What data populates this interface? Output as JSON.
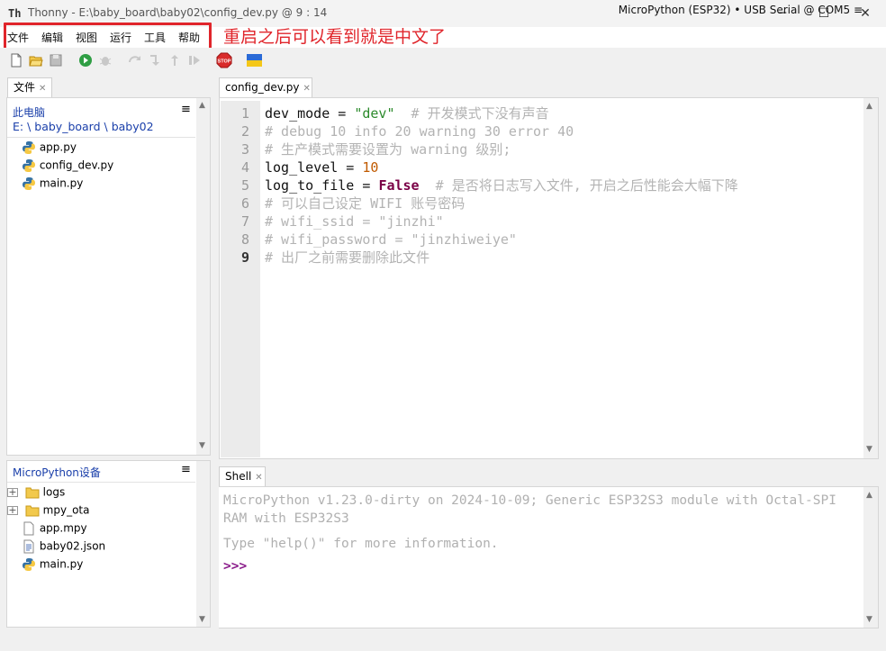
{
  "window": {
    "title": "Thonny  -  E:\\baby_board\\baby02\\config_dev.py  @  9 : 14",
    "logo": "Th",
    "min": "─",
    "max": "☐",
    "close": "✕"
  },
  "menu": {
    "items": [
      "文件",
      "编辑",
      "视图",
      "运行",
      "工具",
      "帮助"
    ]
  },
  "annotation": {
    "text": "重启之后可以看到就是中文了",
    "color": "#e0252b"
  },
  "toolbar": {
    "icons": [
      "new-file-icon",
      "open-folder-icon",
      "save-icon",
      "run-icon",
      "debug-icon",
      "step-over-icon",
      "step-into-icon",
      "step-out-icon",
      "resume-icon",
      "stop-icon",
      "ukraine-flag-icon"
    ],
    "stop_label": "STOP"
  },
  "files_panel": {
    "tab": "文件",
    "location": "此电脑",
    "path": "E: \\ baby_board \\ baby02",
    "files": [
      "app.py",
      "config_dev.py",
      "main.py"
    ]
  },
  "device_panel": {
    "title": "MicroPython设备",
    "items": [
      {
        "name": "logs",
        "kind": "folder"
      },
      {
        "name": "mpy_ota",
        "kind": "folder"
      },
      {
        "name": "app.mpy",
        "kind": "file"
      },
      {
        "name": "baby02.json",
        "kind": "json"
      },
      {
        "name": "main.py",
        "kind": "python"
      }
    ]
  },
  "editor": {
    "tab": "config_dev.py",
    "line_numbers": [
      "1",
      "2",
      "3",
      "4",
      "5",
      "6",
      "7",
      "8",
      "9"
    ],
    "lines": [
      {
        "a": "dev_mode = ",
        "b": "\"dev\"",
        "c": "  # 开发模式下没有声音"
      },
      {
        "c": "# debug 10 info 20 warning 30 error 40"
      },
      {
        "c": "# 生产模式需要设置为 warning 级别;"
      },
      {
        "a": "log_level = ",
        "n": "10"
      },
      {
        "a": "log_to_file = ",
        "k": "False",
        "c": "  # 是否将日志写入文件, 开启之后性能会大幅下降"
      },
      {
        "c": "# 可以自己设定 WIFI 账号密码"
      },
      {
        "c": "# wifi_ssid = \"jinzhi\""
      },
      {
        "c": "# wifi_password = \"jinzhiweiye\""
      },
      {
        "c": "# 出厂之前需要删除此文件"
      }
    ]
  },
  "shell": {
    "tab": "Shell",
    "line1": "MicroPython v1.23.0-dirty on 2024-10-09; Generic ESP32S3 module with Octal-SPI",
    "line2": "RAM with ESP32S3",
    "line3": "Type \"help()\" for more information.",
    "prompt": ">>>"
  },
  "status": {
    "text": "MicroPython (ESP32)  •  USB Serial @ COM5  ≡"
  }
}
